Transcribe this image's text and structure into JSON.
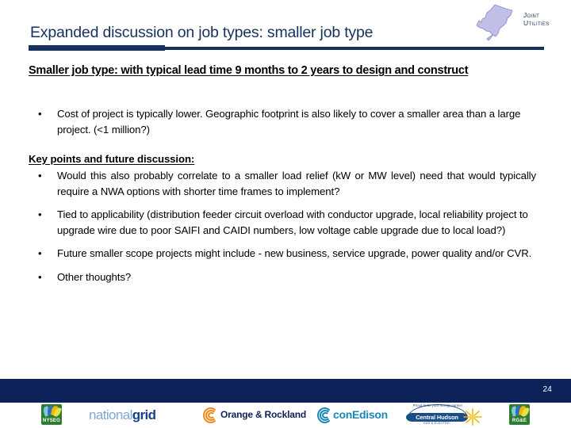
{
  "header": {
    "title": "Expanded discussion on job types: smaller job type",
    "logo": {
      "name": "joint-utilities-logo",
      "line1": "Joint",
      "line2": "Utilities"
    }
  },
  "content": {
    "subhead": "Smaller job type: with typical lead time 9 months to 2 years to design and construct",
    "intro_bullets": [
      {
        "marker": "•",
        "text": "Cost of project is typically lower.  Geographic footprint is also likely to cover a smaller area than a large project. (<1 million?)"
      }
    ],
    "keypoints_heading": "Key points and future discussion:",
    "keypoint_bullets": [
      {
        "marker": "•",
        "text": "Would this also probably correlate to a smaller load relief (kW or MW level) need that would typically require a NWA options with shorter time frames to implement?"
      },
      {
        "marker": "•",
        "text": "Tied to applicability (distribution feeder circuit overload with conductor upgrade, local reliability project to upgrade wire due to poor SAIFI and CAIDI numbers, low voltage cable upgrade due to local load?)"
      },
      {
        "marker": "•",
        "text": "Future smaller scope projects might include - new business, service upgrade, power quality and/or CVR."
      },
      {
        "marker": "•",
        "text": "Other thoughts?"
      }
    ]
  },
  "footer": {
    "page_number": "24",
    "logos": [
      {
        "name": "nyseg-logo",
        "label": "NYSEG"
      },
      {
        "name": "national-grid-logo",
        "label_light": "national",
        "label_bold": "grid"
      },
      {
        "name": "orange-rockland-logo",
        "label": "Orange & Rockland"
      },
      {
        "name": "con-edison-logo",
        "label": "conEdison"
      },
      {
        "name": "central-hudson-logo",
        "arc_text": "Proud to be your energy partner",
        "label": "Central Hudson",
        "sub_label": "GAS & ELECTRIC"
      },
      {
        "name": "rge-logo",
        "label": "RG&E"
      }
    ]
  },
  "colors": {
    "navy": "#17315e",
    "footer_band": "#0d2259",
    "nyseg_green": "#2e7d32",
    "orange": "#f08a1c",
    "conedison_blue": "#1b87b8",
    "central_hudson_blue": "#1b4d86"
  }
}
